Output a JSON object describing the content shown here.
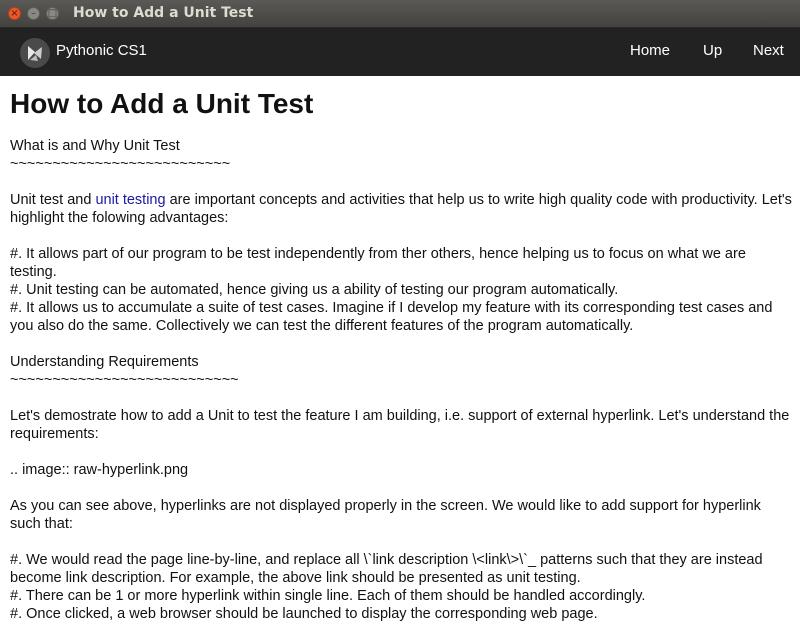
{
  "window": {
    "title": "How to Add a Unit Test"
  },
  "appbar": {
    "brand": "Pythonic CS1",
    "nav": {
      "home": "Home",
      "up": "Up",
      "next": "Next"
    }
  },
  "page": {
    "heading": "How to Add a Unit Test",
    "section1": {
      "title": "What is and Why Unit Test",
      "underline": "~~~~~~~~~~~~~~~~~~~~~~~~~~"
    },
    "intro": {
      "before": "Unit test and ",
      "link": "unit testing",
      "after": " are important concepts and activities that help us to write high quality code with productivity. Let's highlight the folowing advantages:"
    },
    "advantages": [
      "#. It allows part of our program to be test independently from ther others, hence helping us to focus on what we are testing.",
      "#. Unit testing can be automated, hence giving us a ability of testing our program automatically.",
      "#. It allows us to accumulate a suite of test cases. Imagine if I develop my feature with its corresponding test cases and you also do the same. Collectively we can test the different features of the program automatically."
    ],
    "section2": {
      "title": "Understanding Requirements",
      "underline": "~~~~~~~~~~~~~~~~~~~~~~~~~~~"
    },
    "req_intro": "Let's demostrate how to add a Unit to test the feature I am building, i.e. support of external hyperlink. Let's understand the requirements:",
    "image_directive": ".. image:: raw-hyperlink.png",
    "req_text": "As you can see above, hyperlinks are not displayed properly in the screen. We would like to add support for hyperlink such that:",
    "requirements": [
      "#. We would read the page line-by-line, and replace all \\`link description \\<link\\>\\`_ patterns such that they are instead become link description. For example, the above link should be presented as unit testing.",
      "#. There can be 1 or more hyperlink within single line. Each of them should be handled accordingly.",
      "#. Once clicked, a web browser should be launched to display the corresponding web page."
    ]
  }
}
